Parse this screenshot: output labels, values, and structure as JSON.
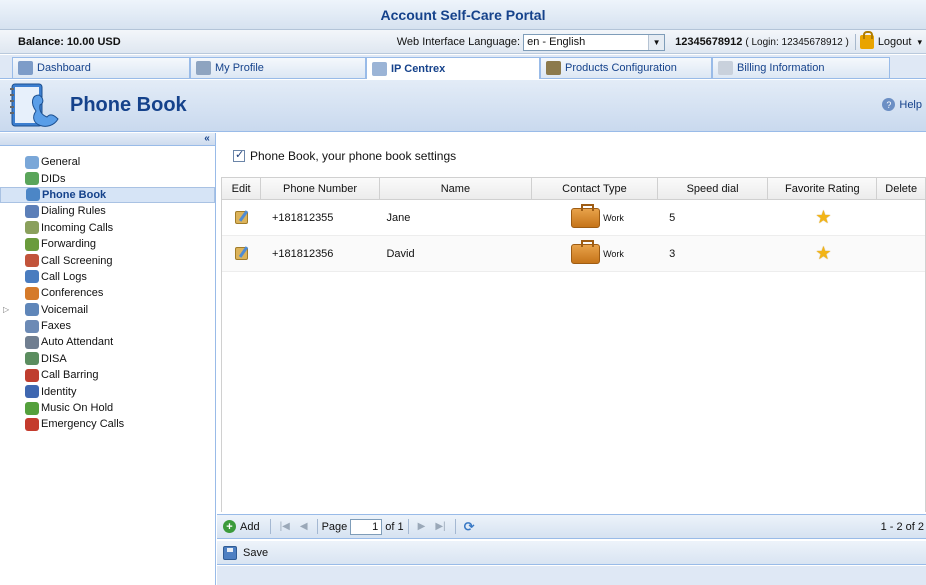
{
  "portal_title": "Account Self-Care Portal",
  "info": {
    "balance": "Balance: 10.00 USD",
    "language_label": "Web Interface Language:",
    "language_value": "en - English",
    "account": "12345678912",
    "login": "( Login: 12345678912 )",
    "logout": "Logout"
  },
  "tabs": [
    {
      "label": "Dashboard"
    },
    {
      "label": "My Profile"
    },
    {
      "label": "IP Centrex"
    },
    {
      "label": "Products Configuration"
    },
    {
      "label": "Billing Information"
    }
  ],
  "header": {
    "title": "Phone Book",
    "help": "Help"
  },
  "sidebar": {
    "collapse": "«",
    "items": [
      {
        "label": "General",
        "icon": "gear-icon",
        "color": "#7aa7d8"
      },
      {
        "label": "DIDs",
        "icon": "did-icon",
        "color": "#5aa55a"
      },
      {
        "label": "Phone Book",
        "icon": "phone-book-icon",
        "color": "#4c86c6"
      },
      {
        "label": "Dialing Rules",
        "icon": "dialing-rules-icon",
        "color": "#5c7fb8"
      },
      {
        "label": "Incoming Calls",
        "icon": "incoming-calls-icon",
        "color": "#8aa05c"
      },
      {
        "label": "Forwarding",
        "icon": "forwarding-icon",
        "color": "#6a9b3c"
      },
      {
        "label": "Call Screening",
        "icon": "call-screening-icon",
        "color": "#c2543b"
      },
      {
        "label": "Call Logs",
        "icon": "call-logs-icon",
        "color": "#4a7cbf"
      },
      {
        "label": "Conferences",
        "icon": "conferences-icon",
        "color": "#d57a2a"
      },
      {
        "label": "Voicemail",
        "icon": "voicemail-icon",
        "color": "#5f86b9"
      },
      {
        "label": "Faxes",
        "icon": "fax-icon",
        "color": "#6c8ab5"
      },
      {
        "label": "Auto Attendant",
        "icon": "auto-attendant-icon",
        "color": "#707e90"
      },
      {
        "label": "DISA",
        "icon": "disa-icon",
        "color": "#5b8d5f"
      },
      {
        "label": "Call Barring",
        "icon": "call-barring-icon",
        "color": "#bf3e2f"
      },
      {
        "label": "Identity",
        "icon": "identity-icon",
        "color": "#3f67b0"
      },
      {
        "label": "Music On Hold",
        "icon": "music-icon",
        "color": "#54a03c"
      },
      {
        "label": "Emergency Calls",
        "icon": "emergency-icon",
        "color": "#c43b2d"
      }
    ]
  },
  "settings_label": "Phone Book, your phone book settings",
  "grid": {
    "columns": [
      "Edit",
      "Phone Number",
      "Name",
      "Contact Type",
      "Speed dial",
      "Favorite Rating",
      "Delete"
    ],
    "rows": [
      {
        "phone": "+181812355",
        "name": "Jane",
        "type": "Work",
        "speed": "5"
      },
      {
        "phone": "+181812356",
        "name": "David",
        "type": "Work",
        "speed": "3"
      }
    ]
  },
  "pager": {
    "add": "Add",
    "page_label": "Page",
    "page_value": "1",
    "of": "of 1",
    "range": "1 - 2 of 2"
  },
  "save": "Save"
}
